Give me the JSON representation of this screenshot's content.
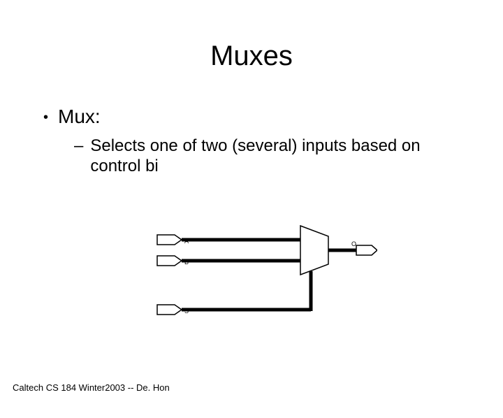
{
  "title": "Muxes",
  "bullets": {
    "level1": "Mux:",
    "level2": "Selects one of two (several) inputs based on control bi"
  },
  "diagram": {
    "inputs": [
      "A",
      "B",
      "S"
    ],
    "output": "O"
  },
  "footer": "Caltech CS 184 Winter2003 -- De. Hon"
}
